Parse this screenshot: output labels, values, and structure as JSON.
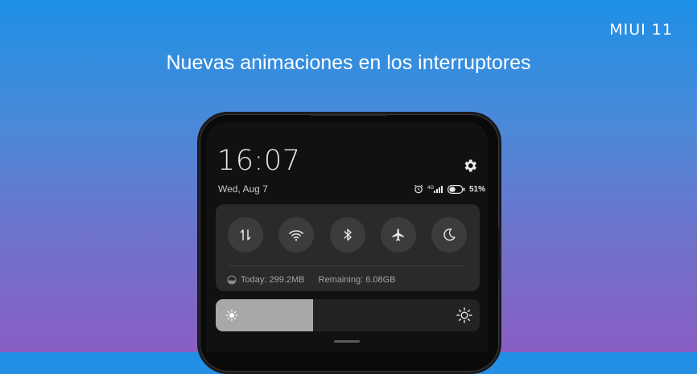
{
  "brand": "MIUI 11",
  "headline": "Nuevas animaciones en los interruptores",
  "phone": {
    "time": "16:07",
    "date": "Wed, Aug 7",
    "status": {
      "icons": [
        "alarm-icon",
        "signal-4g-icon",
        "battery-icon"
      ],
      "network_label": "4G",
      "battery_pct_label": "51%",
      "battery_level": 0.51
    },
    "settings_icon": "gear-icon",
    "toggles": [
      {
        "icon": "mobile-data-icon",
        "name": "mobile-data"
      },
      {
        "icon": "wifi-icon",
        "name": "wifi"
      },
      {
        "icon": "bluetooth-icon",
        "name": "bluetooth"
      },
      {
        "icon": "airplane-icon",
        "name": "airplane-mode"
      },
      {
        "icon": "moon-icon",
        "name": "do-not-disturb"
      }
    ],
    "data_usage": {
      "today": "Today: 299.2MB",
      "remaining": "Remaining: 6.08GB"
    },
    "brightness": {
      "level": 0.37
    }
  },
  "colors": {
    "gradient_top": "#1e90e6",
    "gradient_bottom": "#8a5ec4",
    "panel_bg": "#2a2a2c",
    "toggle_bg": "#3c3c3f",
    "brightness_fill": "#a8a8a8"
  }
}
